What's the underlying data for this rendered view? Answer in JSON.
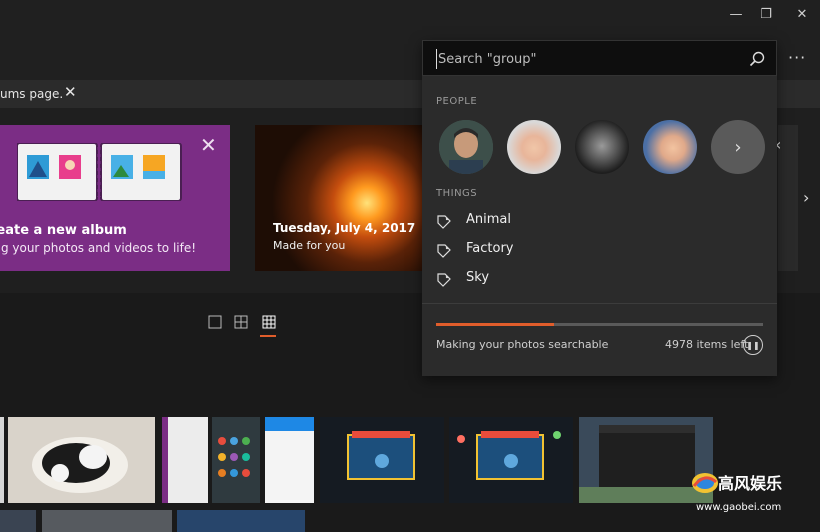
{
  "window": {
    "minimize_glyph": "—",
    "maximize_glyph": "❐",
    "close_glyph": "✕"
  },
  "banner": {
    "text": "ums page.",
    "close_glyph": "✕"
  },
  "album_card": {
    "title": "reate a new album",
    "subtitle": "ing your photos and videos to life!",
    "close_glyph": "✕"
  },
  "memory_card": {
    "title": "Tuesday, July 4, 2017",
    "subtitle": "Made for you"
  },
  "search": {
    "placeholder": "Search \"group\"",
    "value": ""
  },
  "more_glyph": "···",
  "people": {
    "label": "PEOPLE",
    "avatars": [
      {
        "name": "person-1"
      },
      {
        "name": "person-2"
      },
      {
        "name": "person-3"
      },
      {
        "name": "person-4"
      }
    ],
    "more_glyph": "›"
  },
  "things": {
    "label": "THINGS",
    "items": [
      {
        "label": "Animal",
        "icon": "tag-icon"
      },
      {
        "label": "Factory",
        "icon": "tag-icon"
      },
      {
        "label": "Sky",
        "icon": "tag-icon"
      }
    ]
  },
  "indexing": {
    "status": "Making your photos searchable",
    "items_left": "4978 items left",
    "progress": 0.36,
    "pause_glyph": "❚❚"
  },
  "nav": {
    "prev_glyph": "‹",
    "next_glyph": "›"
  },
  "view_toggle": {
    "selected": "small-grid"
  },
  "watermark": {
    "title": "高风娱乐",
    "url": "www.gaobei.com"
  },
  "colors": {
    "accent": "#e05d2b",
    "album_card": "#7b2d85",
    "panel": "#2b2b2b"
  }
}
